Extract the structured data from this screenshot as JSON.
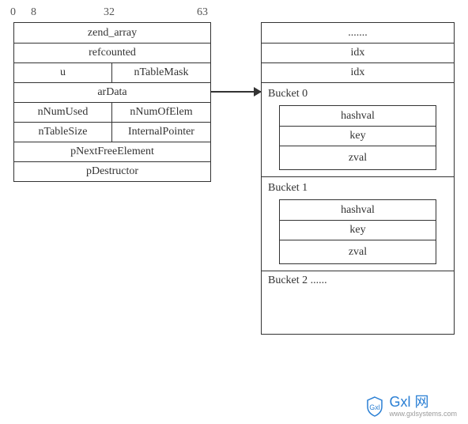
{
  "bits": {
    "b0": "0",
    "b8": "8",
    "b32": "32",
    "b63": "63"
  },
  "left": {
    "r0_full": "zend_array",
    "r1_full": "refcounted",
    "r2_l": "u",
    "r2_r": "nTableMask",
    "r3_full": "arData",
    "r4_l": "nNumUsed",
    "r4_r": "nNumOfElem",
    "r5_l": "nTableSize",
    "r5_r": "InternalPointer",
    "r6_full": "pNextFreeElement",
    "r7_full": "pDestructor"
  },
  "right": {
    "dots": ".......",
    "idx1": "idx",
    "idx2": "idx",
    "bucket0_label": "Bucket 0",
    "bucket1_label": "Bucket 1",
    "bucket2_label": "Bucket 2 ......",
    "field_hashval": "hashval",
    "field_key": "key",
    "field_zval": "zval"
  },
  "watermark": {
    "main": "Gxl 网",
    "sub": "www.gxlsystems.com"
  }
}
